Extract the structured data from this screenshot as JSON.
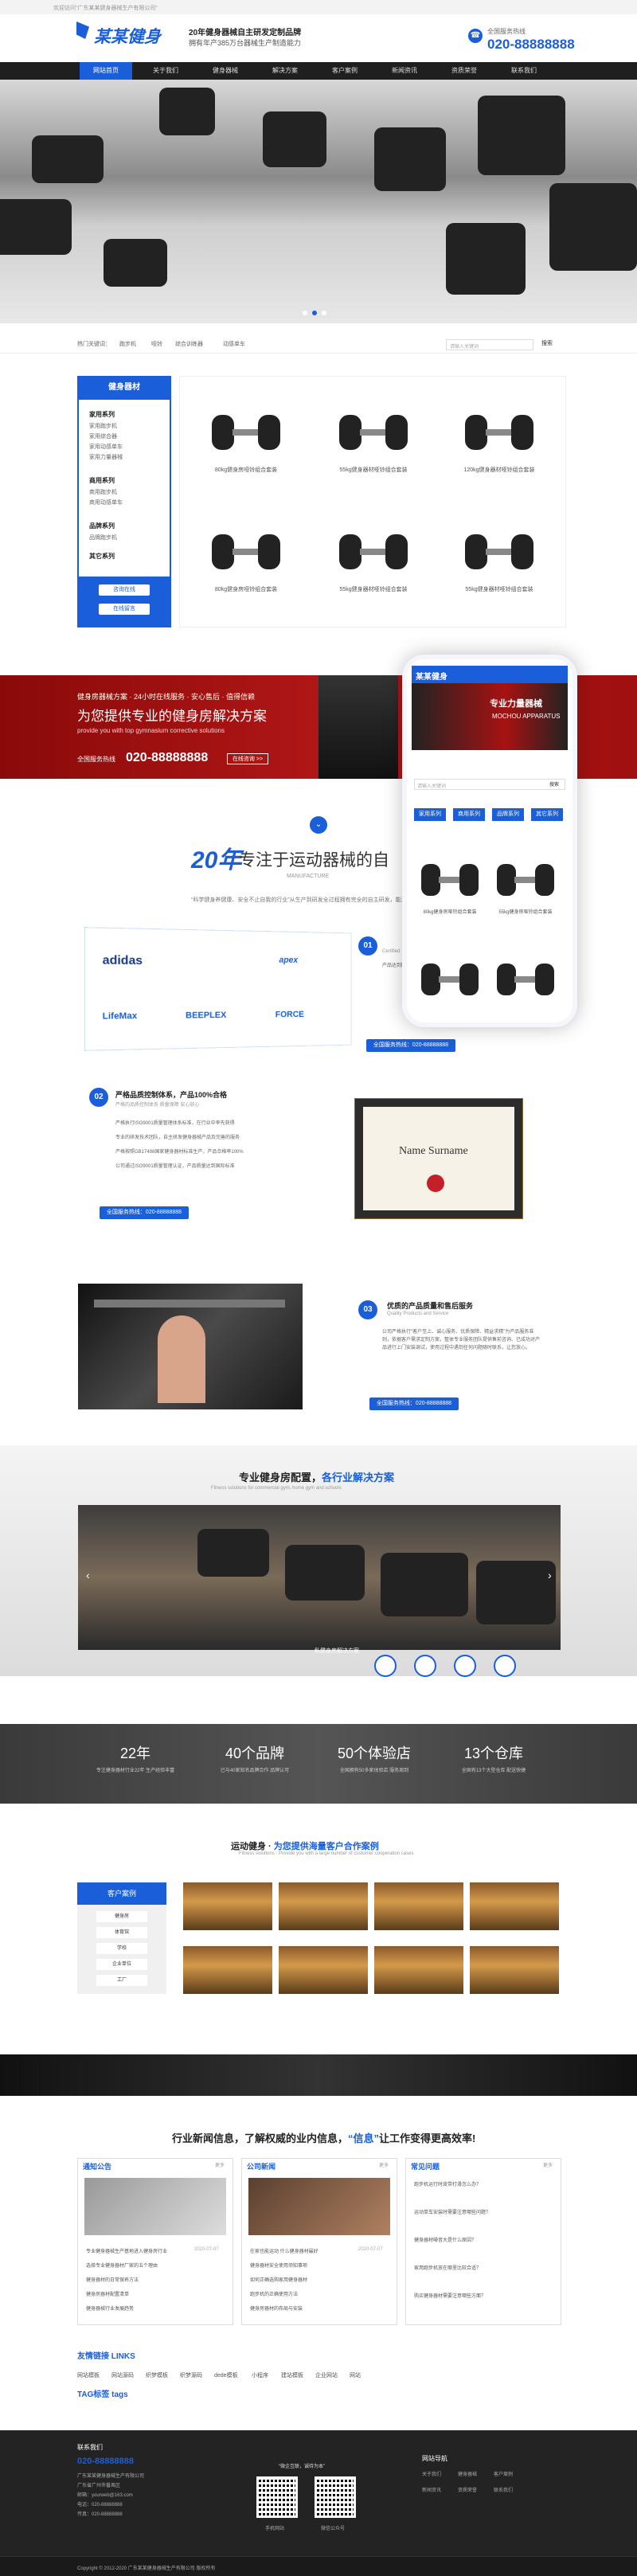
{
  "topbar": {
    "text": "欢迎访问“广东某某健身器械生产有限公司”"
  },
  "header": {
    "logo": "某某健身",
    "slogan_line1": "20年健身器械自主研发定制品牌",
    "slogan_line2": "拥有年产385万台器械生产制造能力",
    "hotline_label": "全国服务热线",
    "phone": "020-88888888"
  },
  "nav": [
    "网站首页",
    "关于我们",
    "健身器械",
    "解决方案",
    "客户案例",
    "新闻资讯",
    "资质荣誉",
    "联系我们"
  ],
  "search": {
    "hot_label": "热门关键词：",
    "keywords": [
      "跑步机",
      "哑铃",
      "综合训练器",
      "动感单车"
    ],
    "placeholder": "请输入关键词",
    "button": "搜索"
  },
  "sidebar": {
    "title": "健身器材",
    "cats": [
      {
        "name": "家用系列",
        "subs": [
          "家用跑步机",
          "家用综合器",
          "家用动感单车",
          "家用力量器械"
        ]
      },
      {
        "name": "商用系列",
        "subs": [
          "商用跑步机",
          "商用动感单车"
        ]
      },
      {
        "name": "品牌系列",
        "subs": [
          "品牌跑步机"
        ]
      },
      {
        "name": "其它系列",
        "subs": []
      }
    ],
    "btn1": "咨询在线",
    "btn2": "在线留言"
  },
  "products": [
    "80kg健身房哑铃组合套装",
    "55kg健身器材哑铃组合套装",
    "120kg健身器材哑铃组合套装",
    "80kg健身房哑铃组合套装",
    "55kg健身器材哑铃组合套装",
    "55kg健身器材哑铃组合套装"
  ],
  "red_band": {
    "line1": "健身房器械方案 · 24小时在线服务 · 安心售后 · 值得信赖",
    "title": "为您提供专业的健身房解决方案",
    "en": "provide you with top gymnasium corrective solutions",
    "tel_label": "全国服务热线",
    "tel": "020-88888888",
    "btn": "在线咨询 >>"
  },
  "mobile": {
    "logo": "某某健身",
    "banner_title": "专业力量器械",
    "banner_sub": "MOCHOU APPARATUS",
    "search_placeholder": "请输入关键词",
    "search_btn": "搜索",
    "nav": [
      "家用系列",
      "商用系列",
      "品牌系列",
      "其它系列"
    ],
    "products": [
      "80kg健身房哑铃组合套装",
      "55kg健身房哑铃组合套装"
    ]
  },
  "intro": {
    "big": "20年",
    "title": "专注于运动器械的自",
    "manufacture": "MANUFACTURE",
    "text": "“科学健身养健康、安全不止自我的行业”从生产到研发全过程拥有完全的自主研发，能满足不同客户需求"
  },
  "brands": [
    "adidas",
    "apex",
    "LifeMax",
    "BEEPLEX",
    "FORCE"
  ],
  "sec1": {
    "num": "01",
    "sub": "Certified",
    "t1": "产品达到国家有关标准",
    "cta": "全国服务热线：020-88888888"
  },
  "sec2": {
    "num": "02",
    "title": "严格品质控制体系，产品100%合格",
    "sub": "严格的品质控制体系 质量保障 安心放心",
    "points": [
      "严格执行ISO9001质量管理体系标准，在行业中率先获得",
      "专业的研发技术团队，自主研发健身器械产品及完善的服务",
      "严格按照GB17498国家健身器材标准生产，产品合格率100%",
      "公司通过ISO9001质量管理认证，产品质量达到国际标准"
    ],
    "cta": "全国服务热线：020-88888888"
  },
  "cert": {
    "name": "Name Surname"
  },
  "sec3": {
    "num": "03",
    "title": "优质的产品质量和售后服务",
    "sub": "Quality Products and Service",
    "text": "公司严格执行\"客户至上、诚心服务、优质保障、精益求精\"为产品服务准则，依据客户需求定制方案，整体专业服务团队提供售前咨询、已成功对产品进行上门安装调试，使用过程中遇到任何问题随时联系，让您放心。",
    "cta": "全国服务热线：020-88888888"
  },
  "config": {
    "title_a": "专业健身房配置，",
    "title_b": "各行业解决方案",
    "sub": "Fitness solutions for commercial gym, home gym and schools",
    "caption": "私健身房解决方案"
  },
  "stats": [
    {
      "n": "22年",
      "t": "专注健身器材行业22年 生产经验丰富"
    },
    {
      "n": "40个品牌",
      "t": "已与40家知名品牌合作 品牌认可"
    },
    {
      "n": "50个体验店",
      "t": "全国拥有50多家体验店 服务周到"
    },
    {
      "n": "13个仓库",
      "t": "全国有13个大型仓库 配送快捷"
    }
  ],
  "cases": {
    "title_a": "运动健身 · ",
    "title_b": "为您提供海量客户合作案例",
    "sub": "Fitness solutions · Provide you with a large number of customer cooperation cases",
    "side_title": "客户案例",
    "btns": [
      "健身房",
      "体育馆",
      "学校",
      "企业单位",
      "工厂"
    ]
  },
  "news": {
    "title_a": "行业新闻信息，了解权威的业内信息，",
    "title_b": "“信息”",
    "title_c": "让工作变得更高效率!",
    "more": "更多",
    "cols": [
      {
        "title": "通知公告",
        "items": [
          "专业健身器械生产基地进入健身房行业",
          "选择专业健身器材厂家的五个理由",
          "健身器材的日常保养方法",
          "健身房器材配置清单",
          "健身器械行业发展趋势"
        ],
        "date": "2020-07-07"
      },
      {
        "title": "公司新闻",
        "items": [
          "在家也能运动 什么健身器材最好",
          "健身器材安全使用须知事项",
          "如何正确选购家用健身器材",
          "跑步机的正确使用方法",
          "健身房器材的布局与安装"
        ],
        "date": "2020-07-07"
      },
      {
        "title": "常见问题",
        "items": [
          "跑步机运行时皮带打滑怎么办？",
          "运动单车安装时需要注意哪些问题？",
          "健身器材噪音大是什么原因？",
          "家用跑步机放在哪里比较合适？",
          "购买健身器材需要注意哪些方面？"
        ]
      }
    ]
  },
  "links": {
    "title": "友情链接 LINKS",
    "items": [
      "网站模板",
      "网站源码",
      "织梦模板",
      "织梦源码",
      "dede模板",
      "小程序",
      "建站模板",
      "企业网站",
      "网站"
    ]
  },
  "tags": {
    "title": "TAG标签 tags"
  },
  "footer": {
    "contact": "联系我们",
    "phone": "020-88888888",
    "company": "广东某某健身器械生产有限公司",
    "addr": "广东省广州市番禺区",
    "mail": "邮箱：yourweb@163.com",
    "tel2": "电话：020-88888888",
    "fax": "传真：020-88888888",
    "qr_title": "“微企互联，诚待为本”",
    "qr1": "手机网站",
    "qr2": "微信公众号",
    "nav_title": "网站导航",
    "nav": [
      "关于我们",
      "健身器械",
      "客户案例",
      "新闻资讯",
      "资质荣誉",
      "联系我们"
    ],
    "copyright": "Copyright © 2012-2020 广东某某健身器械生产有限公司 版权所有"
  }
}
